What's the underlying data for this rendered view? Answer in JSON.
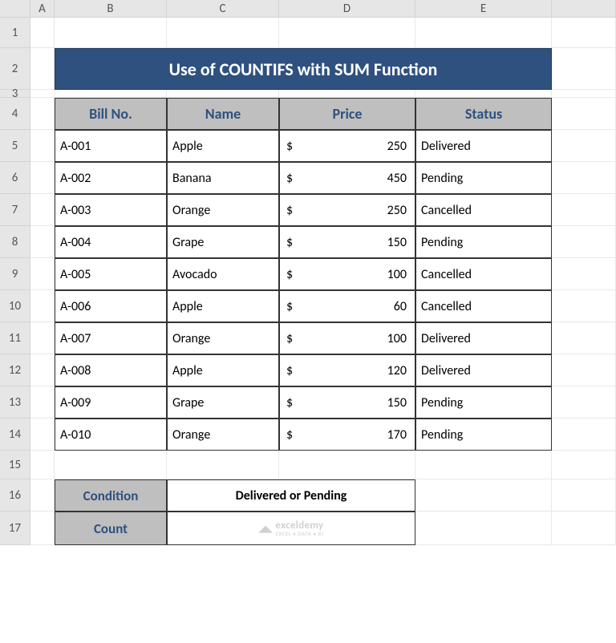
{
  "columns": [
    "",
    "A",
    "B",
    "C",
    "D",
    "E",
    ""
  ],
  "rows": [
    "1",
    "2",
    "3",
    "4",
    "5",
    "6",
    "7",
    "8",
    "9",
    "10",
    "11",
    "12",
    "13",
    "14",
    "15",
    "16",
    "17"
  ],
  "title": "Use of COUNTIFS with SUM Function",
  "headers": {
    "bill": "Bill No.",
    "name": "Name",
    "price": "Price",
    "status": "Status"
  },
  "data": [
    {
      "bill": "A-001",
      "name": "Apple",
      "price": "250",
      "status": "Delivered"
    },
    {
      "bill": "A-002",
      "name": "Banana",
      "price": "450",
      "status": "Pending"
    },
    {
      "bill": "A-003",
      "name": "Orange",
      "price": "250",
      "status": "Cancelled"
    },
    {
      "bill": "A-004",
      "name": "Grape",
      "price": "150",
      "status": "Pending"
    },
    {
      "bill": "A-005",
      "name": "Avocado",
      "price": "100",
      "status": "Cancelled"
    },
    {
      "bill": "A-006",
      "name": "Apple",
      "price": "60",
      "status": "Cancelled"
    },
    {
      "bill": "A-007",
      "name": "Orange",
      "price": "100",
      "status": "Delivered"
    },
    {
      "bill": "A-008",
      "name": "Apple",
      "price": "120",
      "status": "Delivered"
    },
    {
      "bill": "A-009",
      "name": "Grape",
      "price": "150",
      "status": "Pending"
    },
    {
      "bill": "A-010",
      "name": "Orange",
      "price": "170",
      "status": "Pending"
    }
  ],
  "currency": "$",
  "condition": {
    "label": "Condition",
    "value": "Delivered or Pending"
  },
  "count": {
    "label": "Count",
    "value": ""
  },
  "watermark": {
    "line1": "exceldemy",
    "line2": "EXCEL • DATA • BI"
  }
}
